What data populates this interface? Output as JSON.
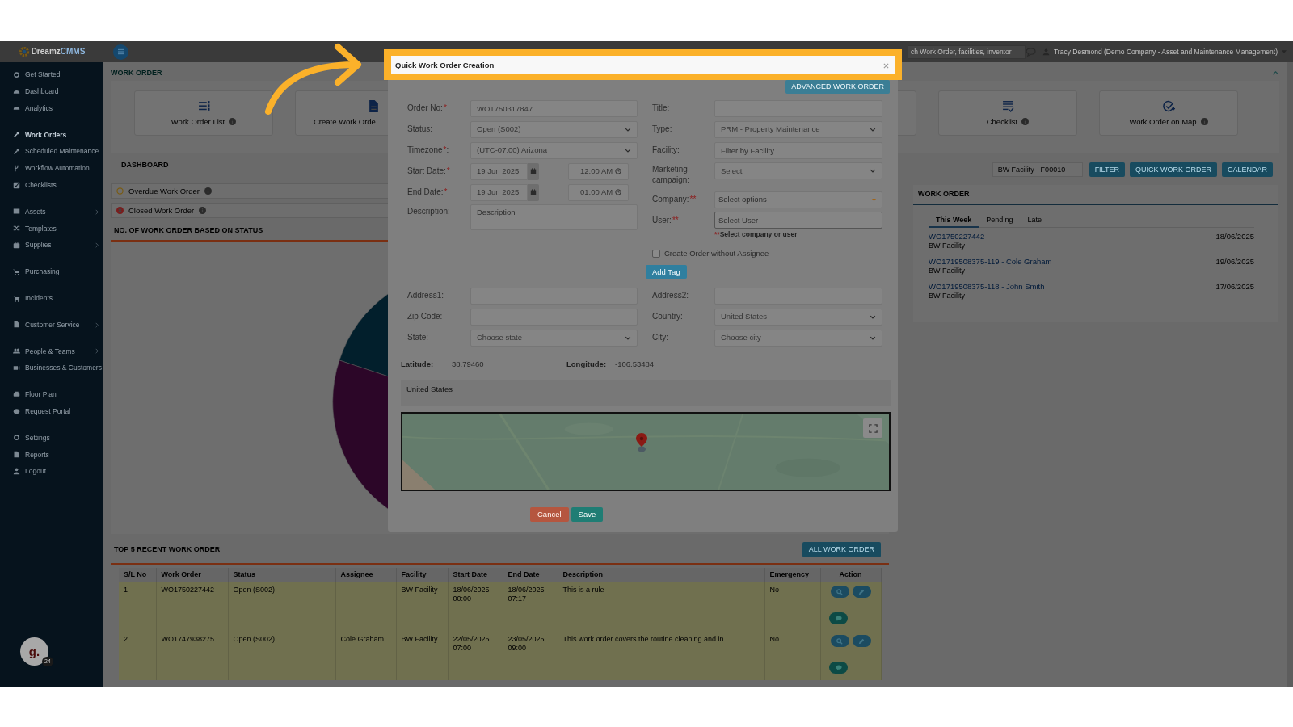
{
  "header": {
    "logo_left": "Dreamz",
    "logo_right": "CMMS",
    "search_placeholder": "ch Work Order, facilities, inventor",
    "user": "Tracy Desmond (Demo Company - Asset and Maintenance Management)"
  },
  "sidebar": {
    "groups": [
      {
        "items": [
          {
            "label": "Get Started",
            "selected": false,
            "submenu": false
          },
          {
            "label": "Dashboard",
            "selected": false,
            "submenu": false
          },
          {
            "label": "Analytics",
            "selected": false,
            "submenu": false
          }
        ]
      },
      {
        "items": [
          {
            "label": "Work Orders",
            "selected": true,
            "submenu": false
          },
          {
            "label": "Scheduled Maintenance",
            "selected": false,
            "submenu": false
          },
          {
            "label": "Workflow Automation",
            "selected": false,
            "submenu": false
          },
          {
            "label": "Checklists",
            "selected": false,
            "submenu": false
          }
        ]
      },
      {
        "items": [
          {
            "label": "Assets",
            "selected": false,
            "submenu": true
          },
          {
            "label": "Templates",
            "selected": false,
            "submenu": false
          },
          {
            "label": "Supplies",
            "selected": false,
            "submenu": true
          }
        ]
      },
      {
        "items": [
          {
            "label": "Purchasing",
            "selected": false,
            "submenu": false
          }
        ]
      },
      {
        "items": [
          {
            "label": "Incidents",
            "selected": false,
            "submenu": false
          }
        ]
      },
      {
        "items": [
          {
            "label": "Customer Service",
            "selected": false,
            "submenu": true
          }
        ]
      },
      {
        "items": [
          {
            "label": "People & Teams",
            "selected": false,
            "submenu": true
          },
          {
            "label": "Businesses & Customers",
            "selected": false,
            "submenu": false
          }
        ]
      },
      {
        "items": [
          {
            "label": "Floor Plan",
            "selected": false,
            "submenu": false
          },
          {
            "label": "Request Portal",
            "selected": false,
            "submenu": false
          }
        ]
      },
      {
        "items": [
          {
            "label": "Settings",
            "selected": false,
            "submenu": false
          },
          {
            "label": "Reports",
            "selected": false,
            "submenu": false
          },
          {
            "label": "Logout",
            "selected": false,
            "submenu": false
          }
        ]
      }
    ]
  },
  "page_title": "WORK ORDER",
  "shortcut_cards": [
    {
      "label": "Work Order List",
      "info": true
    },
    {
      "label": "Create Work Orde",
      "info": false
    },
    {
      "label": "Checklist",
      "info": true
    },
    {
      "label": "Work Order on Map",
      "info": true
    }
  ],
  "dashboard": {
    "title": "DASHBOARD",
    "rows": [
      {
        "label": "Overdue Work Order",
        "kind": "overdue"
      },
      {
        "label": "Closed Work Order",
        "kind": "closed"
      }
    ],
    "chart_title": "NO. OF WORK ORDER BASED ON STATUS"
  },
  "filter": {
    "value": "BW Facility - F00010",
    "buttons": [
      "FILTER",
      "QUICK WORK ORDER",
      "CALENDAR"
    ]
  },
  "work_order_panel": {
    "title": "WORK ORDER",
    "tabs": [
      {
        "label": "This Week",
        "selected": true
      },
      {
        "label": "Pending",
        "selected": false
      },
      {
        "label": "Late",
        "selected": false
      }
    ],
    "items": [
      {
        "title": "WO1750227442 -",
        "facility": "BW Facility",
        "date": "18/06/2025"
      },
      {
        "title": "WO1719508375-119 - Cole Graham",
        "facility": "BW Facility",
        "date": "19/06/2025"
      },
      {
        "title": "WO1719508375-118 - John Smith",
        "facility": "BW Facility",
        "date": "17/06/2025"
      }
    ]
  },
  "recent": {
    "title": "TOP 5 RECENT WORK ORDER",
    "button": "ALL WORK ORDER",
    "columns": [
      "S/L No",
      "Work Order",
      "Status",
      "Assignee",
      "Facility",
      "Start Date",
      "End Date",
      "Description",
      "Emergency",
      "Action"
    ],
    "rows": [
      {
        "sl_no": "1",
        "work_order": "WO1750227442",
        "status": "Open (S002)",
        "facility": "BW Facility",
        "start": "18/06/2025 00:00",
        "end": "18/06/2025 07:17",
        "description": "This is a rule",
        "emergency": "No"
      },
      {
        "sl_no": "2",
        "work_order": "WO1747938275",
        "status": "Open (S002)",
        "assignee": "Cole Graham",
        "facility": "BW Facility",
        "start": "22/05/2025 07:00",
        "end": "23/05/2025 09:00",
        "description": "This work order covers the routine cleaning and in ...",
        "emergency": "No"
      }
    ]
  },
  "modal": {
    "title": "Quick Work Order Creation",
    "advanced_button": "ADVANCED WORK ORDER",
    "left_fields": [
      {
        "kind": "text",
        "label": "Order No:",
        "required": "*",
        "value": "WO1750317847"
      },
      {
        "kind": "select",
        "label": "Status:",
        "value": "Open (S002)"
      },
      {
        "kind": "select",
        "label": "Timezone",
        "required": "*",
        "after": ":",
        "value": "(UTC-07:00) Arizona"
      },
      {
        "kind": "datetime",
        "label": "Start Date:",
        "required": "*",
        "date": "19 Jun 2025",
        "time": "12:00 AM"
      },
      {
        "kind": "datetime",
        "label": "End Date:",
        "required": "*",
        "date": "19 Jun 2025",
        "time": "01:00 AM"
      },
      {
        "kind": "textarea",
        "label": "Description:",
        "placeholder": "Description"
      }
    ],
    "right_fields": [
      {
        "kind": "text",
        "label": "Title:"
      },
      {
        "kind": "select",
        "label": "Type:",
        "value": "PRM - Property Maintenance"
      },
      {
        "kind": "text",
        "label": "Facility:",
        "placeholder": "Filter by Facility"
      },
      {
        "kind": "campaign",
        "label": "Marketing campaign:",
        "value": "Select"
      },
      {
        "kind": "multiselect",
        "label": "Company:",
        "required": "**",
        "value": "Select options"
      },
      {
        "kind": "user",
        "label": "User:",
        "required": "**",
        "placeholder": "Select User"
      }
    ],
    "hint_mark": "**",
    "hint": "Select company or user",
    "checkbox": {
      "label": "Create Order without Assignee",
      "checked": false
    },
    "tag_button": "Add Tag",
    "address_left": [
      {
        "kind": "text",
        "label": "Address1:"
      },
      {
        "kind": "text",
        "label": "Zip Code:"
      },
      {
        "kind": "select",
        "label": "State:",
        "value": "Choose state"
      }
    ],
    "address_right": [
      {
        "kind": "text",
        "label": "Address2:"
      },
      {
        "kind": "select",
        "label": "Country:",
        "value": "United States"
      },
      {
        "kind": "select",
        "label": "City:",
        "value": "Choose city"
      }
    ],
    "latitude_label": "Latitude:",
    "latitude": "38.79460",
    "longitude_label": "Longitude:",
    "longitude": "-106.53484",
    "address_text": "United States",
    "cancel": "Cancel",
    "save": "Save"
  },
  "assistant_widget": {
    "label": "g.",
    "badge": "24"
  }
}
